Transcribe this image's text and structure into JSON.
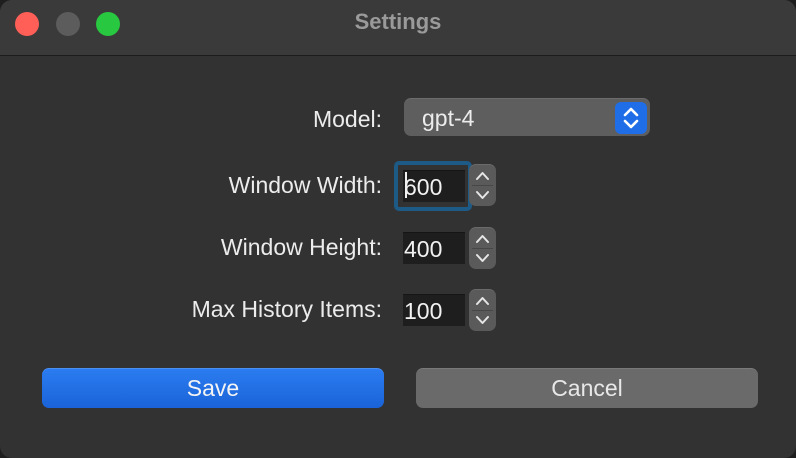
{
  "window": {
    "title": "Settings",
    "traffic_lights": [
      {
        "name": "close",
        "color": "#ff5f57"
      },
      {
        "name": "minimize",
        "color": "#5c5c5c"
      },
      {
        "name": "zoom",
        "color": "#28c840"
      }
    ]
  },
  "form": {
    "model": {
      "label": "Model:",
      "value": "gpt-4"
    },
    "window_width": {
      "label": "Window Width:",
      "value": "600"
    },
    "window_height": {
      "label": "Window Height:",
      "value": "400"
    },
    "max_history": {
      "label": "Max History Items:",
      "value": "100"
    }
  },
  "buttons": {
    "save": "Save",
    "cancel": "Cancel"
  },
  "colors": {
    "accent": "#1f6ee8",
    "focus_ring": "#1d5a86"
  },
  "icons": {
    "select_arrows": "chevron-up-down-icon",
    "stepper": "stepper-arrows-icon"
  }
}
